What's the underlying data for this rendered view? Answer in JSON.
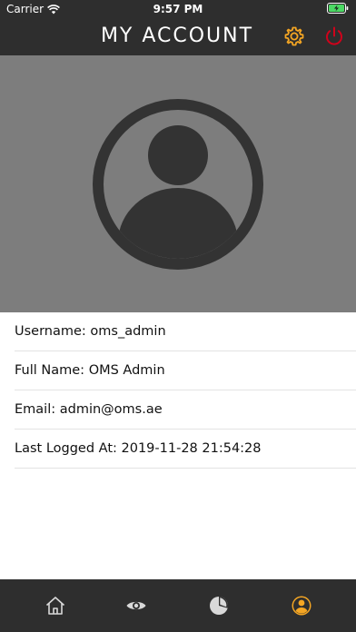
{
  "status_bar": {
    "carrier": "Carrier",
    "time": "9:57 PM"
  },
  "nav": {
    "title": "MY ACCOUNT",
    "settings_icon": "gear-icon",
    "logout_icon": "power-icon"
  },
  "profile": {
    "username_label": "Username: ",
    "username": "oms_admin",
    "fullname_label": "Full Name: ",
    "fullname": "OMS Admin",
    "email_label": "Email: ",
    "email": "admin@oms.ae",
    "last_logged_label": "Last Logged At: ",
    "last_logged": "2019-11-28 21:54:28"
  },
  "tabs": [
    {
      "icon": "home-icon"
    },
    {
      "icon": "eye-icon"
    },
    {
      "icon": "pie-chart-icon"
    },
    {
      "icon": "user-icon",
      "active": true
    }
  ],
  "colors": {
    "bar_background": "#2e2e2e",
    "avatar_background": "#7d7d7d",
    "accent": "#f5a623",
    "logout": "#d0021b"
  }
}
